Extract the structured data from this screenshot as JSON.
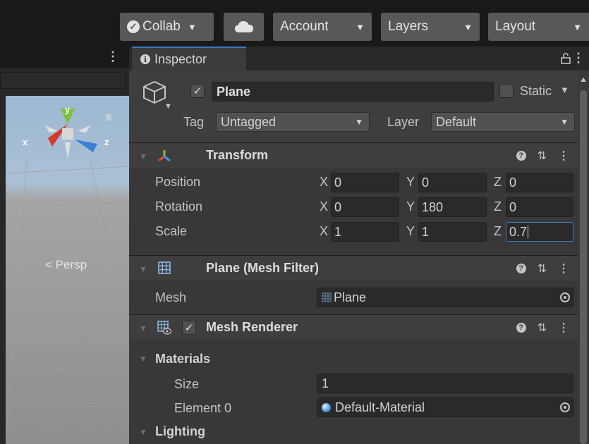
{
  "toolbar": {
    "collab_label": "Collab",
    "cloud_icon": "cloud-icon",
    "account_label": "Account",
    "layers_label": "Layers",
    "layout_label": "Layout"
  },
  "scene": {
    "menu": "⋮",
    "persp_label": "< Persp",
    "axis_x": "x",
    "axis_y": "y",
    "axis_z": "z"
  },
  "inspector": {
    "tab_label": "Inspector",
    "menu": "⋮",
    "object": {
      "active": true,
      "name": "Plane",
      "static_label": "Static",
      "tag_label": "Tag",
      "tag_value": "Untagged",
      "layer_label": "Layer",
      "layer_value": "Default"
    },
    "transform": {
      "title": "Transform",
      "position_label": "Position",
      "rotation_label": "Rotation",
      "scale_label": "Scale",
      "axis_x": "X",
      "axis_y": "Y",
      "axis_z": "Z",
      "position": {
        "x": "0",
        "y": "0",
        "z": "0"
      },
      "rotation": {
        "x": "0",
        "y": "180",
        "z": "0"
      },
      "scale": {
        "x": "1",
        "y": "1",
        "z": "0.7"
      }
    },
    "mesh_filter": {
      "title": "Plane (Mesh Filter)",
      "mesh_label": "Mesh",
      "mesh_value": "Plane"
    },
    "mesh_renderer": {
      "title": "Mesh Renderer",
      "enabled": true,
      "materials_label": "Materials",
      "size_label": "Size",
      "size_value": "1",
      "element0_label": "Element 0",
      "element0_value": "Default-Material",
      "lighting_label": "Lighting"
    }
  },
  "colors": {
    "accent": "#3a79bb",
    "panel_bg": "#383838",
    "toolbar_button": "#585858"
  }
}
